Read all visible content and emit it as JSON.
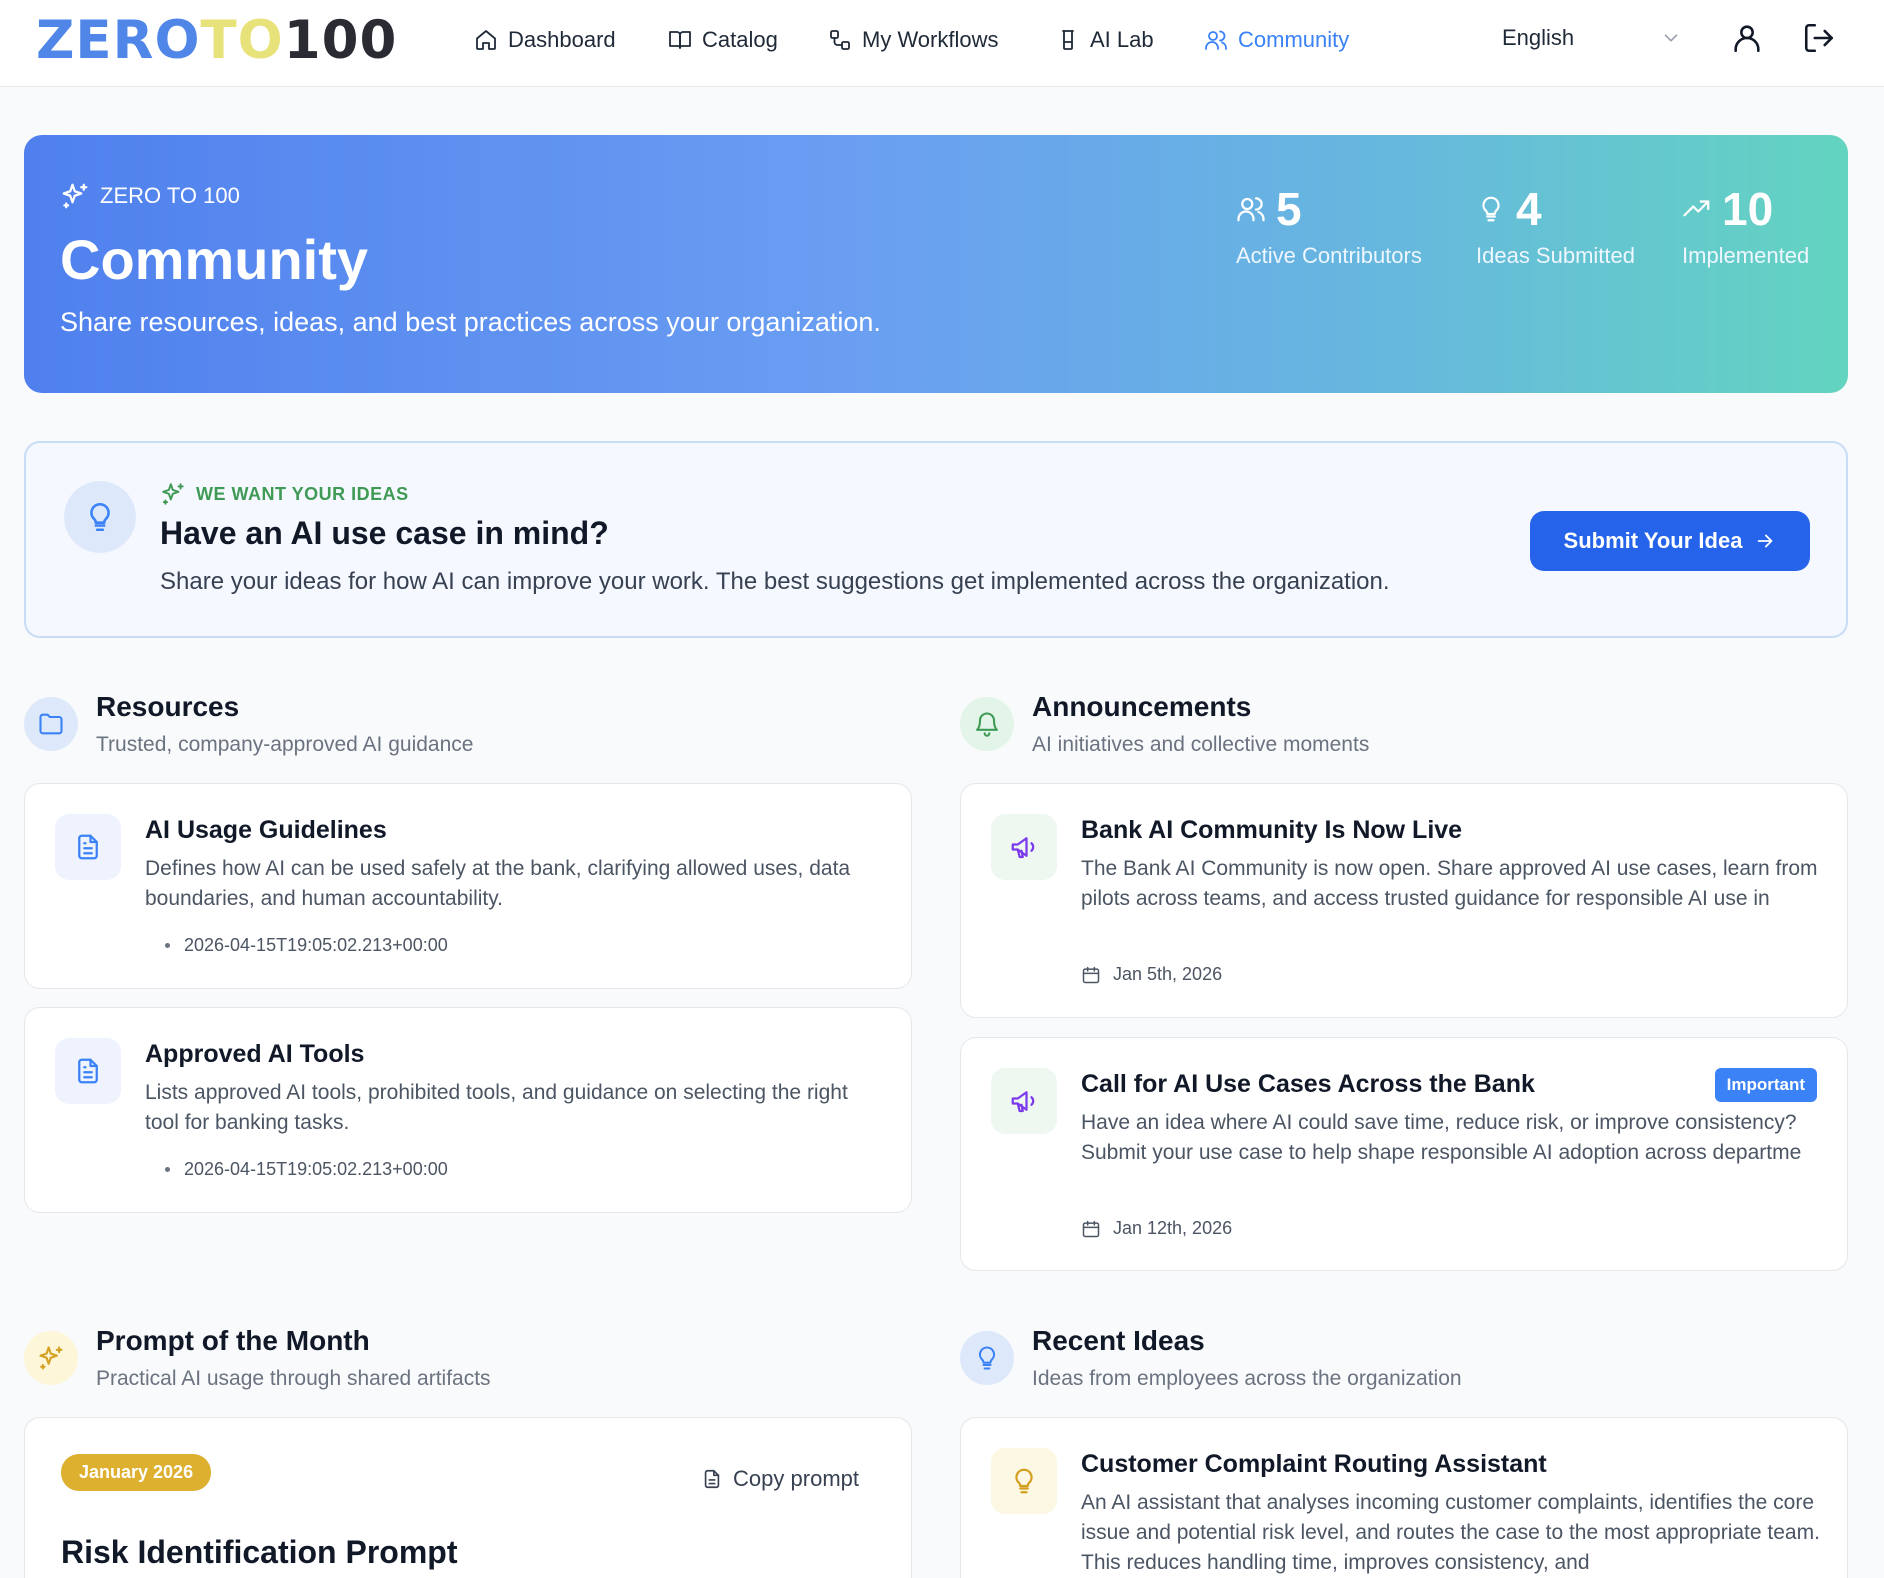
{
  "brand": {
    "logo_part1": "ZERO",
    "logo_part2": "TO",
    "logo_part3": "100"
  },
  "nav": {
    "items": [
      {
        "label": "Dashboard",
        "icon": "home-icon"
      },
      {
        "label": "Catalog",
        "icon": "book-icon"
      },
      {
        "label": "My Workflows",
        "icon": "workflow-icon"
      },
      {
        "label": "AI Lab",
        "icon": "flask-icon"
      },
      {
        "label": "Community",
        "icon": "users-icon",
        "active": true
      }
    ],
    "language": "English"
  },
  "hero": {
    "kicker": "ZERO TO 100",
    "title": "Community",
    "subtitle": "Share resources, ideas, and best practices across your organization.",
    "stats": [
      {
        "value": "5",
        "label": "Active Contributors",
        "icon": "users-icon"
      },
      {
        "value": "4",
        "label": "Ideas Submitted",
        "icon": "lightbulb-icon"
      },
      {
        "value": "10",
        "label": "Implemented",
        "icon": "trending-up-icon"
      }
    ]
  },
  "ideas_banner": {
    "kicker": "WE WANT YOUR IDEAS",
    "title": "Have an AI use case in mind?",
    "text": "Share your ideas for how AI can improve your work. The best suggestions get implemented across the organization.",
    "button_label": "Submit Your Idea"
  },
  "resources": {
    "title": "Resources",
    "subtitle": "Trusted, company-approved AI guidance",
    "items": [
      {
        "title": "AI Usage Guidelines",
        "text": "Defines how AI can be used safely at the bank, clarifying allowed uses, data boundaries, and human accountability.",
        "meta": "2026-04-15T19:05:02.213+00:00"
      },
      {
        "title": "Approved AI Tools",
        "text": "Lists approved AI tools, prohibited tools, and guidance on selecting the right tool for banking tasks.",
        "meta": "2026-04-15T19:05:02.213+00:00"
      }
    ]
  },
  "announcements": {
    "title": "Announcements",
    "subtitle": "AI initiatives and collective moments",
    "items": [
      {
        "title": "Bank AI Community Is Now Live",
        "text": "The Bank AI Community is now open. Share approved AI use cases, learn from pilots across teams, and access trusted guidance for responsible AI use in",
        "date": "Jan 5th, 2026"
      },
      {
        "title": "Call for AI Use Cases Across the Bank",
        "badge": "Important",
        "text": "Have an idea where AI could save time, reduce risk, or improve consistency? Submit your use case to help shape responsible AI adoption across departme",
        "date": "Jan 12th, 2026"
      }
    ]
  },
  "prompt_of_month": {
    "title": "Prompt of the Month",
    "subtitle": "Practical AI usage through shared artifacts",
    "month": "January 2026",
    "copy_label": "Copy prompt",
    "prompt_title": "Risk Identification Prompt"
  },
  "recent_ideas": {
    "title": "Recent Ideas",
    "subtitle": "Ideas from employees across the organization",
    "items": [
      {
        "title": "Customer Complaint Routing Assistant",
        "text": "An AI assistant that analyses incoming customer complaints, identifies the core issue and potential risk level, and routes the case to the most appropriate team. This reduces handling time, improves consistency, and"
      }
    ]
  },
  "colors": {
    "accent": "#2563eb",
    "nav_active": "#3b82f6",
    "ideas_kicker": "#3f9a55",
    "month_badge": "#ddb02f",
    "announcement_icon": "#7c3aed"
  }
}
